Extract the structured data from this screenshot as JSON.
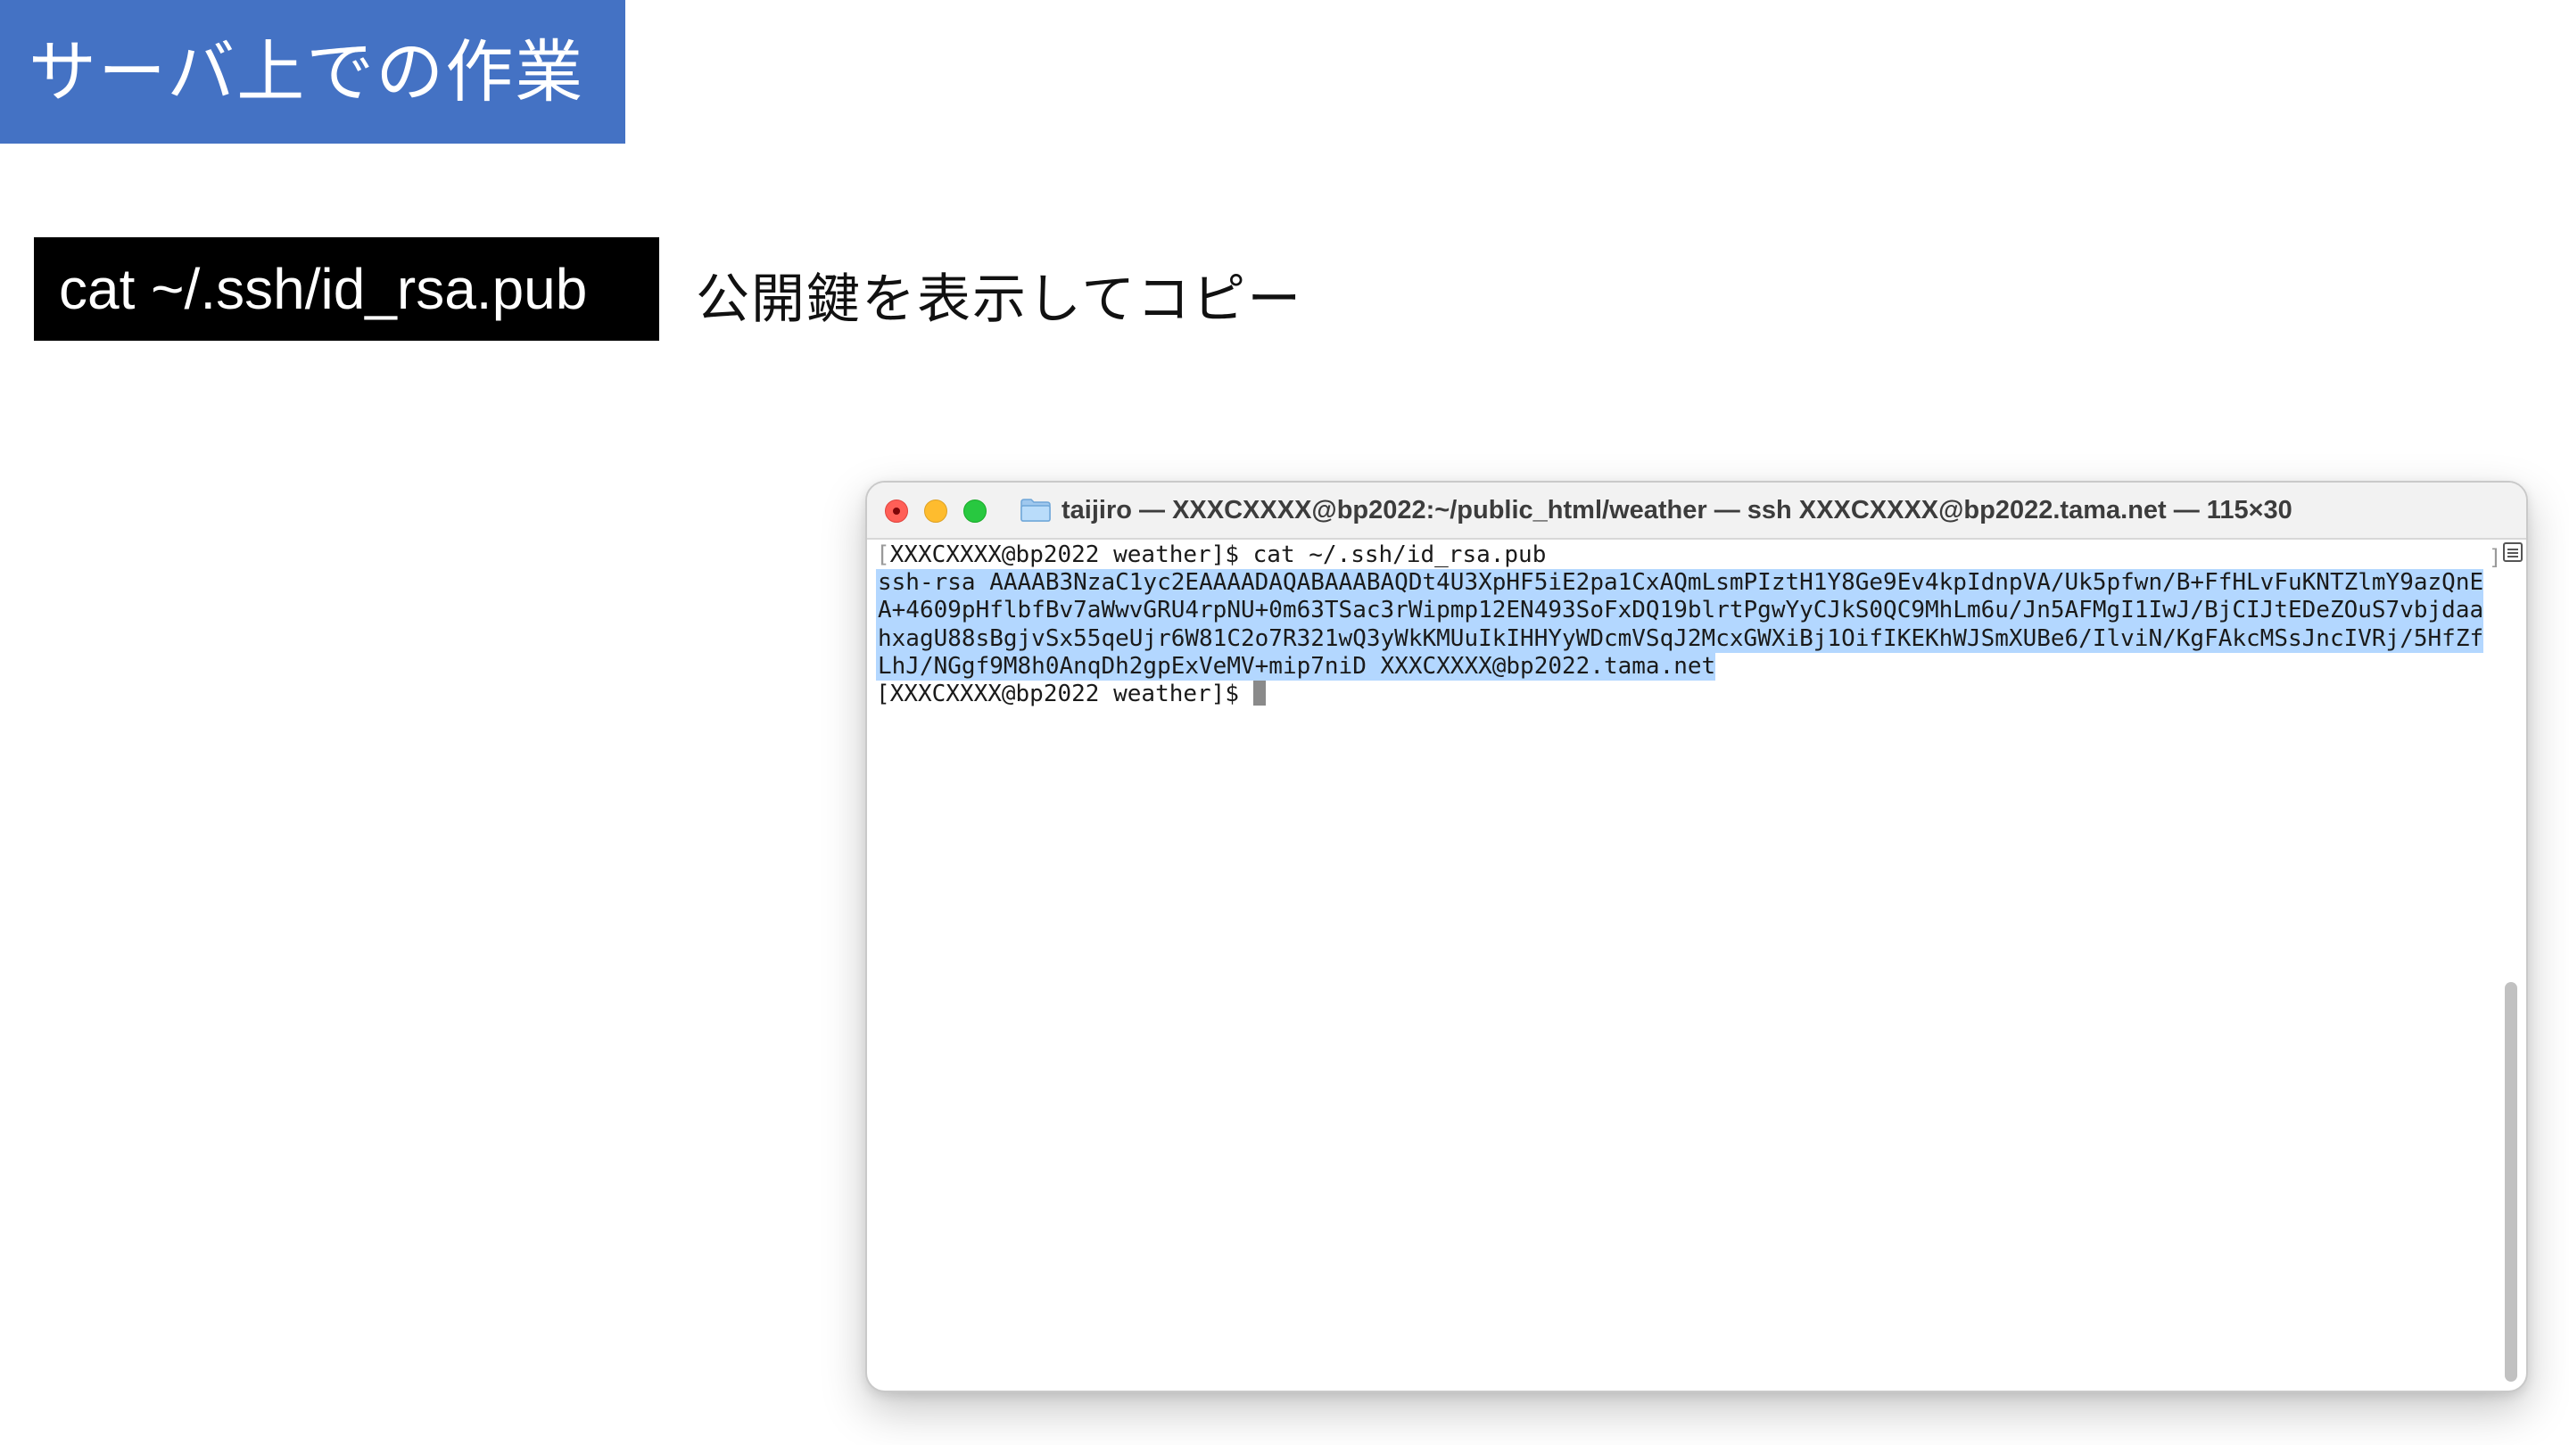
{
  "slide": {
    "title": "サーバ上での作業",
    "command": "cat ~/.ssh/id_rsa.pub",
    "description": "公開鍵を表示してコピー"
  },
  "terminal": {
    "window_title": "taijiro — XXXCXXXX@bp2022:~/public_html/weather — ssh XXXCXXXX@bp2022.tama.net — 115×30",
    "prompt_line": "XXXCXXXX@bp2022 weather]$ cat ~/.ssh/id_rsa.pub",
    "open_bracket": "[",
    "key_lines": [
      "ssh-rsa AAAAB3NzaC1yc2EAAAADAQABAAABAQDt4U3XpHF5iE2pa1CxAQmLsmPIztH1Y8Ge9Ev4kpIdnpVA/Uk5pfwn/B+FfHLvFuKNTZlmY9azQnE",
      "A+4609pHflbfBv7aWwvGRU4rpNU+0m63TSac3rWipmp12EN493SoFxDQ19blrtPgwYyCJkS0QC9MhLm6u/Jn5AFMgI1IwJ/BjCIJtEDeZOuS7vbjdaa",
      "hxagU88sBgjvSx55qeUjr6W81C2o7R321wQ3yWkKMUuIkIHHYyWDcmVSqJ2McxGWXiBj1OifIKEKhWJSmXUBe6/IlviN/KgFAkcMSsJncIVRj/5HfZf",
      "LhJ/NGgf9M8h0AnqDh2gpExVeMV+mip7niD XXXCXXXX@bp2022.tama.net"
    ],
    "final_prompt": "[XXXCXXXX@bp2022 weather]$ ",
    "right_bracket": "]",
    "colors": {
      "selection": "#b3d7ff",
      "close": "#ff5f57",
      "minimize": "#febc2e",
      "maximize": "#28c840",
      "title_banner": "#4472c4"
    }
  }
}
